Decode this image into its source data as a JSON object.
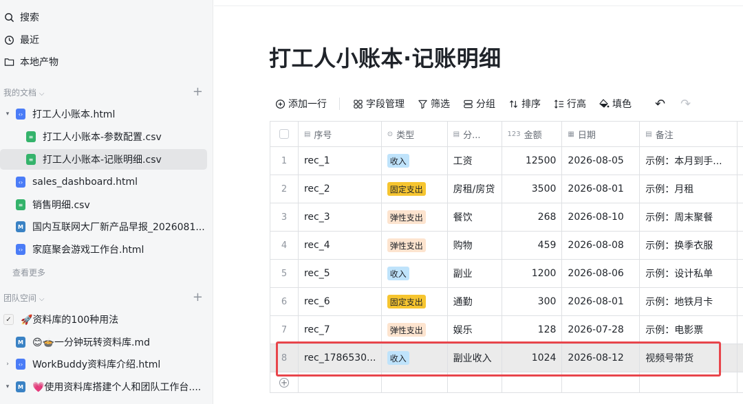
{
  "sidebar": {
    "nav": [
      {
        "label": "搜索",
        "icon": "search-icon"
      },
      {
        "label": "最近",
        "icon": "clock-icon"
      },
      {
        "label": "本地产物",
        "icon": "folder-icon"
      }
    ],
    "my_docs": {
      "title": "我的文档",
      "items": [
        {
          "label": "打工人小账本.html",
          "type": "html"
        },
        {
          "label": "打工人小账本-参数配置.csv",
          "type": "csv"
        },
        {
          "label": "打工人小账本-记账明细.csv",
          "type": "csv"
        },
        {
          "label": "sales_dashboard.html",
          "type": "html"
        },
        {
          "label": "销售明细.csv",
          "type": "csv"
        },
        {
          "label": "国内互联网大厂新产品早报_2026081...",
          "type": "md"
        },
        {
          "label": "家庭聚会游戏工作台.html",
          "type": "html"
        }
      ],
      "more": "查看更多"
    },
    "team": {
      "title": "团队空间",
      "items": [
        {
          "label": "🚀资料库的100种用法",
          "type": "emoji"
        },
        {
          "label": "😊🍲一分钟玩转资料库.md",
          "type": "md"
        },
        {
          "label": "WorkBuddy资料库介绍.html",
          "type": "html"
        },
        {
          "label": "💗使用资料库搭建个人和团队工作台....",
          "type": "md"
        }
      ]
    }
  },
  "doc": {
    "title": "打工人小账本·记账明细"
  },
  "toolbar": {
    "add_row": "添加一行",
    "fields": "字段管理",
    "filter": "筛选",
    "group": "分组",
    "sort": "排序",
    "row_height": "行高",
    "fill": "填色"
  },
  "table": {
    "headers": {
      "id": "序号",
      "type": "类型",
      "category": "分...",
      "amount_prefix": "123",
      "amount": "金额",
      "date": "日期",
      "note": "备注"
    },
    "rows": [
      {
        "n": "1",
        "id": "rec_1",
        "type": "收入",
        "category": "工资",
        "amount": "12500",
        "date": "2026-08-05",
        "note": "示例：本月到手..."
      },
      {
        "n": "2",
        "id": "rec_2",
        "type": "固定支出",
        "category": "房租/房贷",
        "amount": "3500",
        "date": "2026-08-01",
        "note": "示例：月租"
      },
      {
        "n": "3",
        "id": "rec_3",
        "type": "弹性支出",
        "category": "餐饮",
        "amount": "268",
        "date": "2026-08-10",
        "note": "示例：周末聚餐"
      },
      {
        "n": "4",
        "id": "rec_4",
        "type": "弹性支出",
        "category": "购物",
        "amount": "459",
        "date": "2026-08-08",
        "note": "示例：换季衣服"
      },
      {
        "n": "5",
        "id": "rec_5",
        "type": "收入",
        "category": "副业",
        "amount": "1200",
        "date": "2026-08-06",
        "note": "示例：设计私单"
      },
      {
        "n": "6",
        "id": "rec_6",
        "type": "固定支出",
        "category": "通勤",
        "amount": "300",
        "date": "2026-08-01",
        "note": "示例：地铁月卡"
      },
      {
        "n": "7",
        "id": "rec_7",
        "type": "弹性支出",
        "category": "娱乐",
        "amount": "128",
        "date": "2026-07-28",
        "note": "示例：电影票"
      },
      {
        "n": "8",
        "id": "rec_1786530...",
        "type": "收入",
        "category": "副业收入",
        "amount": "1024",
        "date": "2026-08-12",
        "note": "视频号带货"
      }
    ]
  },
  "colors": {
    "income": "#bfe3fb",
    "fixed": "#f6c530",
    "flex": "#fde4cf",
    "highlight_border": "#e8454b"
  }
}
